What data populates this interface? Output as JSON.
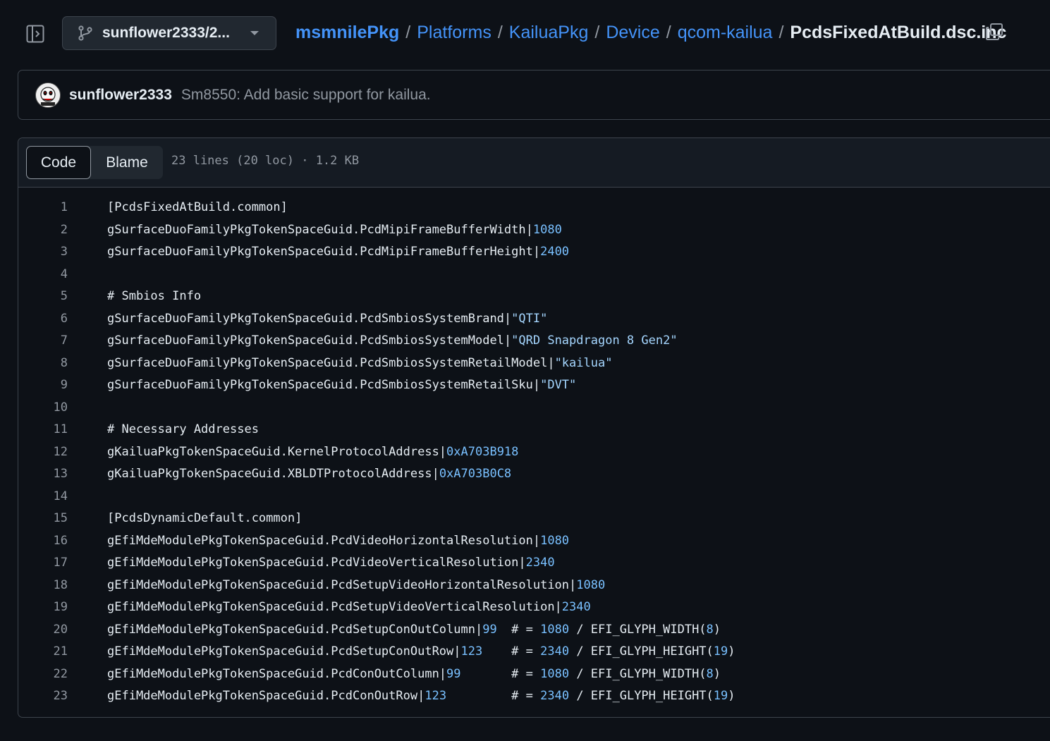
{
  "header": {
    "branch_label": "sunflower2333/2...",
    "breadcrumb": [
      "msmnilePkg",
      "Platforms",
      "KailuaPkg",
      "Device",
      "qcom-kailua"
    ],
    "separator": "/",
    "current_file": "PcdsFixedAtBuild.dsc.inc"
  },
  "commit": {
    "author": "sunflower2333",
    "message": "Sm8550: Add basic support for kailua."
  },
  "file": {
    "tabs": [
      "Code",
      "Blame"
    ],
    "active_tab": "Code",
    "meta": "23 lines (20 loc) · 1.2 KB"
  },
  "code": [
    {
      "n": "1",
      "parts": [
        [
          "plain",
          "[PcdsFixedAtBuild.common]"
        ]
      ]
    },
    {
      "n": "2",
      "parts": [
        [
          "plain",
          "gSurfaceDuoFamilyPkgTokenSpaceGuid.PcdMipiFrameBufferWidth|"
        ],
        [
          "const",
          "1080"
        ]
      ]
    },
    {
      "n": "3",
      "parts": [
        [
          "plain",
          "gSurfaceDuoFamilyPkgTokenSpaceGuid.PcdMipiFrameBufferHeight|"
        ],
        [
          "const",
          "2400"
        ]
      ]
    },
    {
      "n": "4",
      "parts": []
    },
    {
      "n": "5",
      "parts": [
        [
          "plain",
          "# Smbios Info"
        ]
      ]
    },
    {
      "n": "6",
      "parts": [
        [
          "plain",
          "gSurfaceDuoFamilyPkgTokenSpaceGuid.PcdSmbiosSystemBrand|"
        ],
        [
          "str",
          "\"QTI\""
        ]
      ]
    },
    {
      "n": "7",
      "parts": [
        [
          "plain",
          "gSurfaceDuoFamilyPkgTokenSpaceGuid.PcdSmbiosSystemModel|"
        ],
        [
          "str",
          "\"QRD Snapdragon 8 Gen2\""
        ]
      ]
    },
    {
      "n": "8",
      "parts": [
        [
          "plain",
          "gSurfaceDuoFamilyPkgTokenSpaceGuid.PcdSmbiosSystemRetailModel|"
        ],
        [
          "str",
          "\"kailua\""
        ]
      ]
    },
    {
      "n": "9",
      "parts": [
        [
          "plain",
          "gSurfaceDuoFamilyPkgTokenSpaceGuid.PcdSmbiosSystemRetailSku|"
        ],
        [
          "str",
          "\"DVT\""
        ]
      ]
    },
    {
      "n": "10",
      "parts": []
    },
    {
      "n": "11",
      "parts": [
        [
          "plain",
          "# Necessary Addresses"
        ]
      ]
    },
    {
      "n": "12",
      "parts": [
        [
          "plain",
          "gKailuaPkgTokenSpaceGuid.KernelProtocolAddress|"
        ],
        [
          "const",
          "0xA703B918"
        ]
      ]
    },
    {
      "n": "13",
      "parts": [
        [
          "plain",
          "gKailuaPkgTokenSpaceGuid.XBLDTProtocolAddress|"
        ],
        [
          "const",
          "0xA703B0C8"
        ]
      ]
    },
    {
      "n": "14",
      "parts": []
    },
    {
      "n": "15",
      "parts": [
        [
          "plain",
          "[PcdsDynamicDefault.common]"
        ]
      ]
    },
    {
      "n": "16",
      "parts": [
        [
          "plain",
          "gEfiMdeModulePkgTokenSpaceGuid.PcdVideoHorizontalResolution|"
        ],
        [
          "const",
          "1080"
        ]
      ]
    },
    {
      "n": "17",
      "parts": [
        [
          "plain",
          "gEfiMdeModulePkgTokenSpaceGuid.PcdVideoVerticalResolution|"
        ],
        [
          "const",
          "2340"
        ]
      ]
    },
    {
      "n": "18",
      "parts": [
        [
          "plain",
          "gEfiMdeModulePkgTokenSpaceGuid.PcdSetupVideoHorizontalResolution|"
        ],
        [
          "const",
          "1080"
        ]
      ]
    },
    {
      "n": "19",
      "parts": [
        [
          "plain",
          "gEfiMdeModulePkgTokenSpaceGuid.PcdSetupVideoVerticalResolution|"
        ],
        [
          "const",
          "2340"
        ]
      ]
    },
    {
      "n": "20",
      "parts": [
        [
          "plain",
          "gEfiMdeModulePkgTokenSpaceGuid.PcdSetupConOutColumn|"
        ],
        [
          "const",
          "99"
        ],
        [
          "plain",
          "  # = "
        ],
        [
          "const",
          "1080"
        ],
        [
          "plain",
          " / EFI_GLYPH_WIDTH("
        ],
        [
          "const",
          "8"
        ],
        [
          "plain",
          ")"
        ]
      ]
    },
    {
      "n": "21",
      "parts": [
        [
          "plain",
          "gEfiMdeModulePkgTokenSpaceGuid.PcdSetupConOutRow|"
        ],
        [
          "const",
          "123"
        ],
        [
          "plain",
          "    # = "
        ],
        [
          "const",
          "2340"
        ],
        [
          "plain",
          " / EFI_GLYPH_HEIGHT("
        ],
        [
          "const",
          "19"
        ],
        [
          "plain",
          ")"
        ]
      ]
    },
    {
      "n": "22",
      "parts": [
        [
          "plain",
          "gEfiMdeModulePkgTokenSpaceGuid.PcdConOutColumn|"
        ],
        [
          "const",
          "99"
        ],
        [
          "plain",
          "       # = "
        ],
        [
          "const",
          "1080"
        ],
        [
          "plain",
          " / EFI_GLYPH_WIDTH("
        ],
        [
          "const",
          "8"
        ],
        [
          "plain",
          ")"
        ]
      ]
    },
    {
      "n": "23",
      "parts": [
        [
          "plain",
          "gEfiMdeModulePkgTokenSpaceGuid.PcdConOutRow|"
        ],
        [
          "const",
          "123"
        ],
        [
          "plain",
          "         # = "
        ],
        [
          "const",
          "2340"
        ],
        [
          "plain",
          " / EFI_GLYPH_HEIGHT("
        ],
        [
          "const",
          "19"
        ],
        [
          "plain",
          ")"
        ]
      ]
    }
  ],
  "colors": {
    "background": "#0d1117",
    "link": "#4493f8",
    "constant": "#79c0ff",
    "string": "#a5d6ff",
    "muted": "#9198a1"
  },
  "icons": {
    "sidebar_toggle": "sidebar-expand-icon",
    "branch": "git-branch-icon",
    "caret": "triangle-down-icon",
    "copy": "copy-icon",
    "avatar": "avatar-face-icon"
  }
}
